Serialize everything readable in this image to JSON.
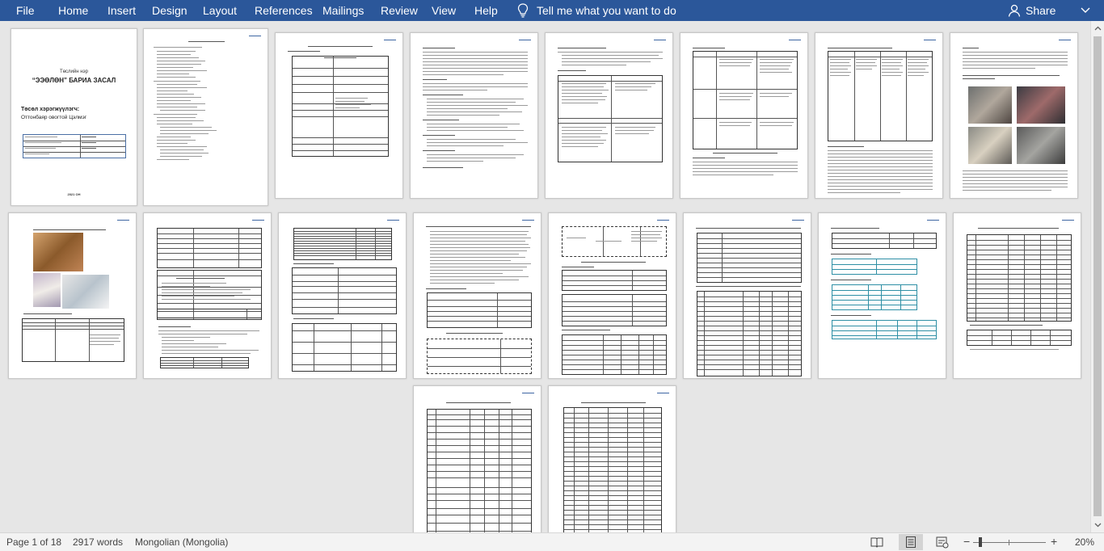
{
  "ribbon": {
    "tabs": [
      {
        "label": "File"
      },
      {
        "label": "Home"
      },
      {
        "label": "Insert"
      },
      {
        "label": "Design"
      },
      {
        "label": "Layout"
      },
      {
        "label": "References"
      },
      {
        "label": "Mailings"
      },
      {
        "label": "Review"
      },
      {
        "label": "View"
      },
      {
        "label": "Help"
      }
    ],
    "tell_me": "Tell me what you want to do",
    "share": "Share",
    "accent": "#2b579a"
  },
  "cover": {
    "line1": "Төслийн нэр",
    "title": "“ЭЭӨЛӨН” БАРИА ЗАСАЛ",
    "submitter_label": "Төсөл хэрэгжүүлэгч:",
    "submitter_name": "Оттонбаяр овогтой Цэлмэг",
    "year": "2021 ОН"
  },
  "status": {
    "page": "Page 1 of 18",
    "words": "2917 words",
    "language": "Mongolian (Mongolia)",
    "zoom": "20%"
  }
}
